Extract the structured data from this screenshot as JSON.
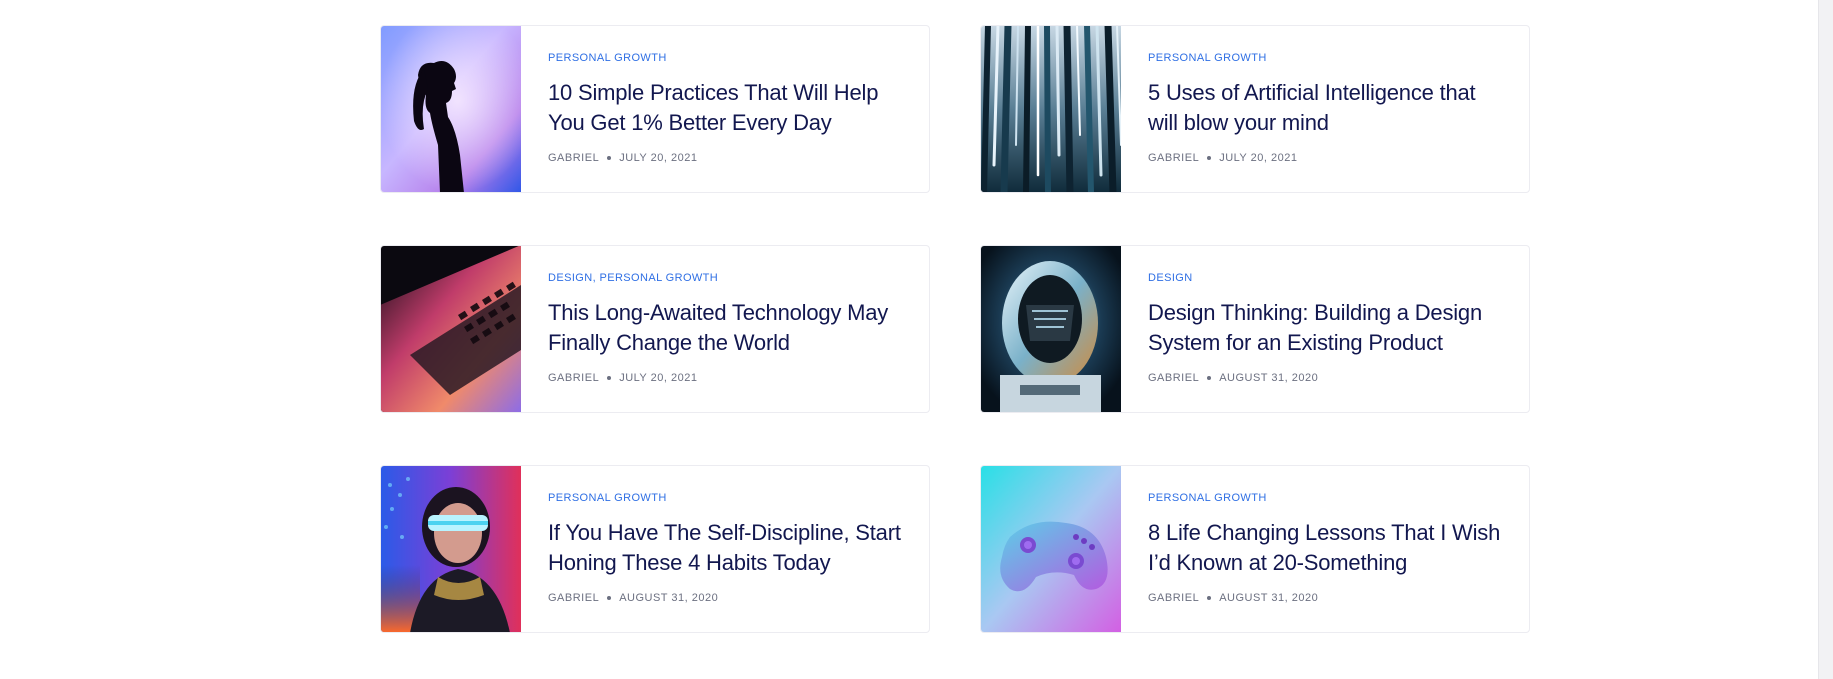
{
  "posts": [
    {
      "category": "PERSONAL GROWTH",
      "title": "10 Simple Practices That Will Help You Get 1% Better Every Day",
      "author": "GABRIEL",
      "date": "JULY 20, 2021",
      "image": "silhouette-woman-image"
    },
    {
      "category": "PERSONAL GROWTH",
      "title": "5 Uses of Artificial Intelligence that will blow your mind",
      "author": "GABRIEL",
      "date": "JULY 20, 2021",
      "image": "light-streaks-image"
    },
    {
      "category": "DESIGN, PERSONAL GROWTH",
      "title": "This Long-Awaited Technology May Finally Change the World",
      "author": "GABRIEL",
      "date": "JULY 20, 2021",
      "image": "laptop-keyboard-image"
    },
    {
      "category": "DESIGN",
      "title": "Design Thinking: Building a Design System for an Existing Product",
      "author": "GABRIEL",
      "date": "AUGUST 31, 2020",
      "image": "astronaut-helmet-image"
    },
    {
      "category": "PERSONAL GROWTH",
      "title": "If You Have The Self-Discipline, Start Honing These 4 Habits Today",
      "author": "GABRIEL",
      "date": "AUGUST 31, 2020",
      "image": "neon-visor-woman-image"
    },
    {
      "category": "PERSONAL GROWTH",
      "title": "8 Life Changing Lessons That I Wish I’d Known at 20-Something",
      "author": "GABRIEL",
      "date": "AUGUST 31, 2020",
      "image": "game-controller-image"
    }
  ],
  "colors": {
    "category": "#2f6fe4",
    "title": "#12174f",
    "meta": "#6b6f80"
  }
}
